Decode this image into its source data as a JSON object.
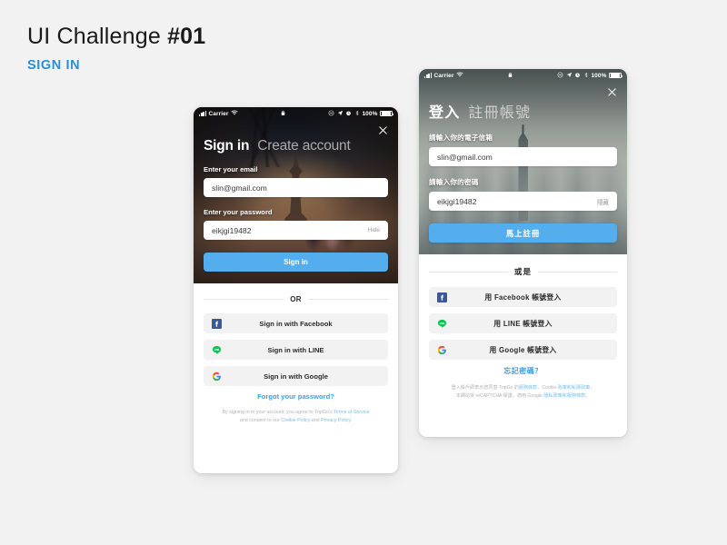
{
  "heading": {
    "title_prefix": "UI Challenge ",
    "title_number": "#01",
    "subtitle": "SIGN IN"
  },
  "statusbar": {
    "carrier": "Carrier",
    "battery_percent": "100%",
    "icons": [
      "signal-bars-icon",
      "wifi-icon",
      "lock-icon",
      "do-not-disturb-icon",
      "location-arrow-icon",
      "alarm-clock-icon",
      "bluetooth-icon",
      "battery-icon"
    ]
  },
  "phone_en": {
    "close_icon": "close-icon",
    "tabs": {
      "active": "Sign in",
      "inactive": "Create account"
    },
    "email": {
      "label": "Enter your email",
      "value": "slin@gmail.com"
    },
    "password": {
      "label": "Enter your password",
      "value": "eikjgi19482",
      "toggle": "Hide"
    },
    "submit": "Sign in",
    "divider": "OR",
    "social": [
      {
        "icon": "facebook-icon",
        "label": "Sign in with Facebook"
      },
      {
        "icon": "line-icon",
        "label": "Sign in with LINE"
      },
      {
        "icon": "google-icon",
        "label": "Sign in with Google"
      }
    ],
    "forgot": "Forgot your password?",
    "legal": {
      "l1a": "By signing in to your account, you agree to TripGo's ",
      "l1b": "Terms of Service",
      "l2a": "and consent to our ",
      "l2b": "Cookie Policy",
      "l2c": " and ",
      "l2d": "Privacy Policy",
      "l2e": "."
    }
  },
  "phone_zh": {
    "close_icon": "close-icon",
    "tabs": {
      "active": "登入",
      "inactive": "註冊帳號"
    },
    "email": {
      "label": "請輸入你的電子信箱",
      "value": "slin@gmail.com"
    },
    "password": {
      "label": "請輸入你的密碼",
      "value": "eikjgi19482",
      "toggle": "隱藏"
    },
    "submit": "馬上註冊",
    "divider": "或是",
    "social": [
      {
        "icon": "facebook-icon",
        "label": "用 Facebook 帳號登入"
      },
      {
        "icon": "line-icon",
        "label": "用 LINE 帳號登入"
      },
      {
        "icon": "google-icon",
        "label": "用 Google 帳號登入"
      }
    ],
    "forgot": "忘記密碼？",
    "legal": {
      "l1a": "登入帳戶即表示您同意 TripGo 的",
      "l1b": "服務條款",
      "l1c": "、Cookie ",
      "l1d": "政策和私隱政策",
      "l1e": "。",
      "l2a": "本網站受 reCAPTCHA 保護，適用 Google ",
      "l2b": "隱私政策和服務條款",
      "l2c": "。"
    }
  },
  "colors": {
    "accent_blue": "#54aeee",
    "link_blue": "#3c9fe0",
    "subtitle_blue": "#2a8fd8",
    "page_bg": "#f2f2f2",
    "field_bg": "#f2f2f2"
  }
}
